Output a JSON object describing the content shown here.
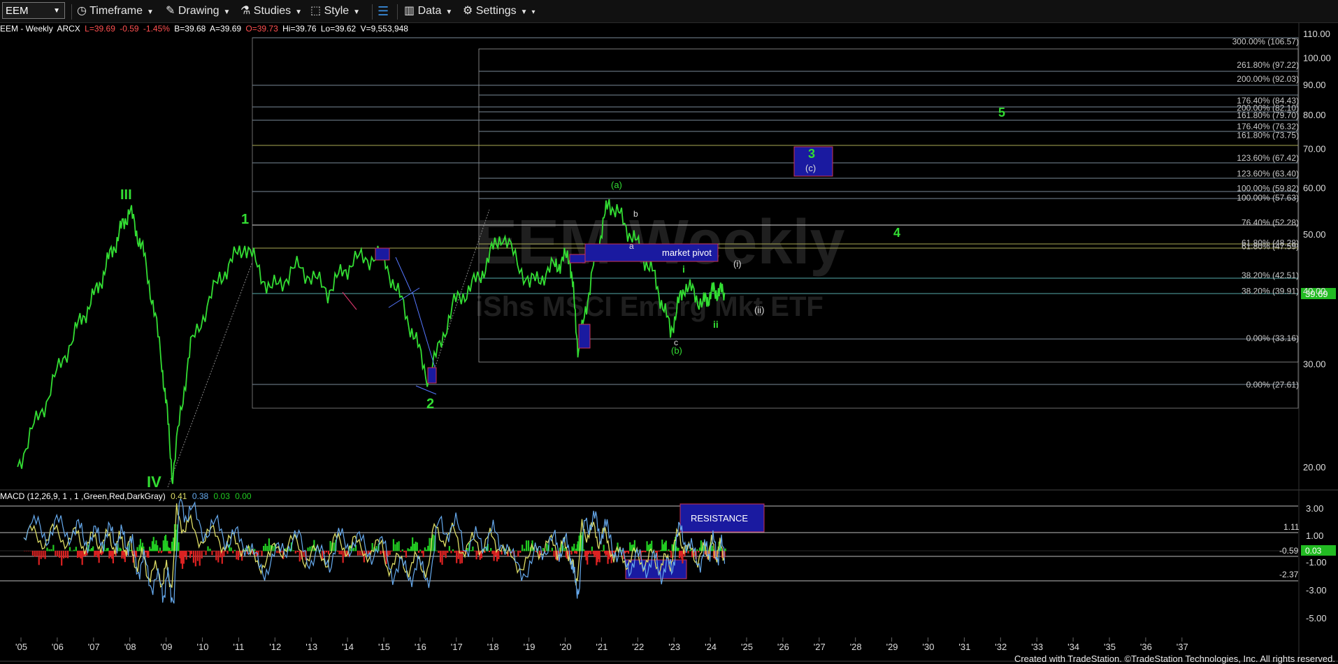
{
  "toolbar": {
    "symbol": "EEM",
    "timeframe": "Timeframe",
    "drawing": "Drawing",
    "studies": "Studies",
    "style": "Style",
    "data": "Data",
    "settings": "Settings"
  },
  "header": {
    "name": "EEM - Weekly",
    "exchange": "ARCX",
    "last": "L=39.69",
    "change": "-0.59",
    "pct": "-1.45%",
    "bid": "B=39.68",
    "ask": "A=39.69",
    "open": "O=39.73",
    "high": "Hi=39.76",
    "low": "Lo=39.62",
    "volume": "V=9,553,948"
  },
  "watermark": {
    "line1": "EEM Weekly",
    "line2": "iShs MSCI Emerg Mkt ETF"
  },
  "price_axis": [
    "110.00",
    "100.00",
    "90.00",
    "80.00",
    "70.00",
    "60.00",
    "50.00",
    "40.00",
    "30.00",
    "20.00"
  ],
  "last_price_tag": "39.69",
  "fib_labels": [
    "300.00% (106.57)",
    "261.80% (97.22)",
    "200.00% (92.03)",
    "176.40% (84.43)",
    "200.00% (82.10)",
    "161.80% (79.70)",
    "176.40% (76.32)",
    "161.80% (73.75)",
    "123.60% (67.42)",
    "123.60% (63.40)",
    "100.00% (59.82)",
    "100.00% (57.63)",
    "76.40% (52.28)",
    "61.80% (48.28)",
    "61.80% (47.59)",
    "38.20% (42.51)",
    "38.20% (39.91)",
    "0.00% (33.16)",
    "0.00% (27.61)"
  ],
  "wave_labels": [
    "III",
    "IV",
    "1",
    "2",
    "3",
    "4",
    "5",
    "(a)",
    "(b)",
    "(c)",
    "a",
    "b",
    "c",
    "i",
    "ii",
    "(i)",
    "(ii)"
  ],
  "annotations": {
    "market_pivot": "market pivot",
    "resistance": "RESISTANCE"
  },
  "macd": {
    "label": "MACD (12,26,9, 1 , 1 ,Green,Red,DarkGray)",
    "v1": "0.41",
    "v2": "0.38",
    "v3": "0.03",
    "v4": "0.00",
    "axis": [
      "3.00",
      "1.00",
      "-1.00",
      "-3.00",
      "-5.00"
    ],
    "levels": [
      "1.11",
      "-0.59",
      "-2.37"
    ],
    "tag": "0.03"
  },
  "x_axis": [
    "'05",
    "'06",
    "'07",
    "'08",
    "'09",
    "'10",
    "'11",
    "'12",
    "'13",
    "'14",
    "'15",
    "'16",
    "'17",
    "'18",
    "'19",
    "'20",
    "'21",
    "'22",
    "'23",
    "'24",
    "'25",
    "'26",
    "'27",
    "'28",
    "'29",
    "'30",
    "'31",
    "'32",
    "'33",
    "'34",
    "'35",
    "'36",
    "'37"
  ],
  "footer": "Created with TradeStation. ©TradeStation Technologies, Inc. All rights reserved.",
  "colors": {
    "price": "#33dd33",
    "macd_up": "#22cc22",
    "macd_down": "#dd2222",
    "box": "#1a1aa0"
  },
  "chart_data": {
    "type": "line",
    "x": [
      2004.7,
      2005.5,
      2006.3,
      2006.9,
      2007.4,
      2007.8,
      2008.2,
      2008.7,
      2009.0,
      2009.5,
      2010.3,
      2011.0,
      2011.7,
      2012.5,
      2013.3,
      2014.0,
      2014.8,
      2015.5,
      2016.1,
      2016.8,
      2017.5,
      2018.1,
      2018.9,
      2019.6,
      2020.0,
      2020.25,
      2020.7,
      2021.1,
      2021.7,
      2022.3,
      2022.8,
      2023.2,
      2023.7,
      2024.0,
      2024.3
    ],
    "values": [
      20,
      26,
      34,
      40,
      48,
      55,
      46,
      30,
      19,
      32,
      42,
      48,
      40,
      44,
      40,
      45,
      46,
      36,
      28,
      38,
      42,
      50,
      41,
      44,
      46,
      31,
      45,
      57,
      50,
      43,
      34,
      41,
      38,
      40,
      39.69
    ],
    "ylabel": "",
    "ylim": [
      16,
      112
    ],
    "xlim": [
      2004.5,
      2038.5
    ]
  }
}
